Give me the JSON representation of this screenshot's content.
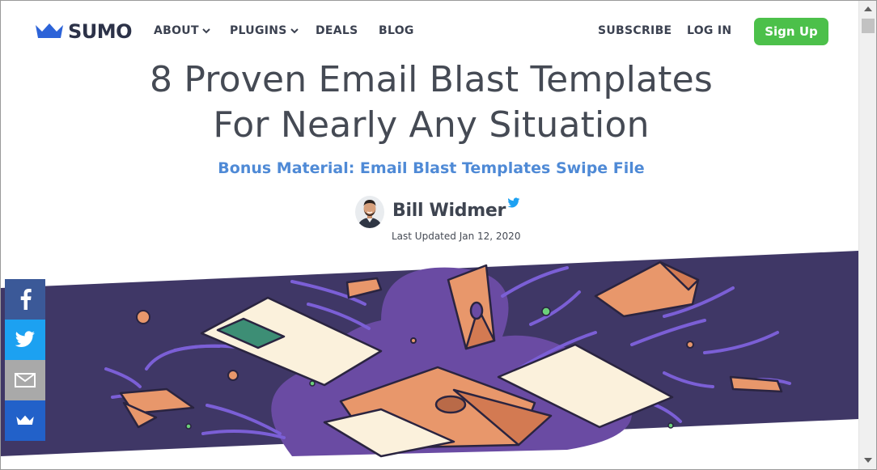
{
  "brand": {
    "name": "SUMO",
    "logo_icon": "crown-icon",
    "color": "#2c63d8"
  },
  "nav": {
    "about": "ABOUT",
    "plugins": "PLUGINS",
    "deals": "DEALS",
    "blog": "BLOG",
    "subscribe": "SUBSCRIBE",
    "login": "LOG IN",
    "signup": "Sign Up"
  },
  "article": {
    "title_line1": "8 Proven Email Blast Templates",
    "title_line2": "For Nearly Any Situation",
    "bonus_link": "Bonus Material: Email Blast Templates Swipe File",
    "author": "Bill Widmer",
    "updated": "Last Updated Jan 12, 2020"
  },
  "share": {
    "items": [
      {
        "icon": "facebook-icon",
        "color": "#3b5998"
      },
      {
        "icon": "twitter-icon",
        "color": "#1ca1f1"
      },
      {
        "icon": "email-icon",
        "color": "#a9a9a9"
      },
      {
        "icon": "sumo-crown-icon",
        "color": "#2261c9"
      }
    ]
  },
  "colors": {
    "accent_green": "#4cc04a",
    "link_blue": "#4f8ad6",
    "banner_bg": "#3f3766",
    "envelope_orange": "#e8976b",
    "paper_cream": "#fbf1dc"
  }
}
